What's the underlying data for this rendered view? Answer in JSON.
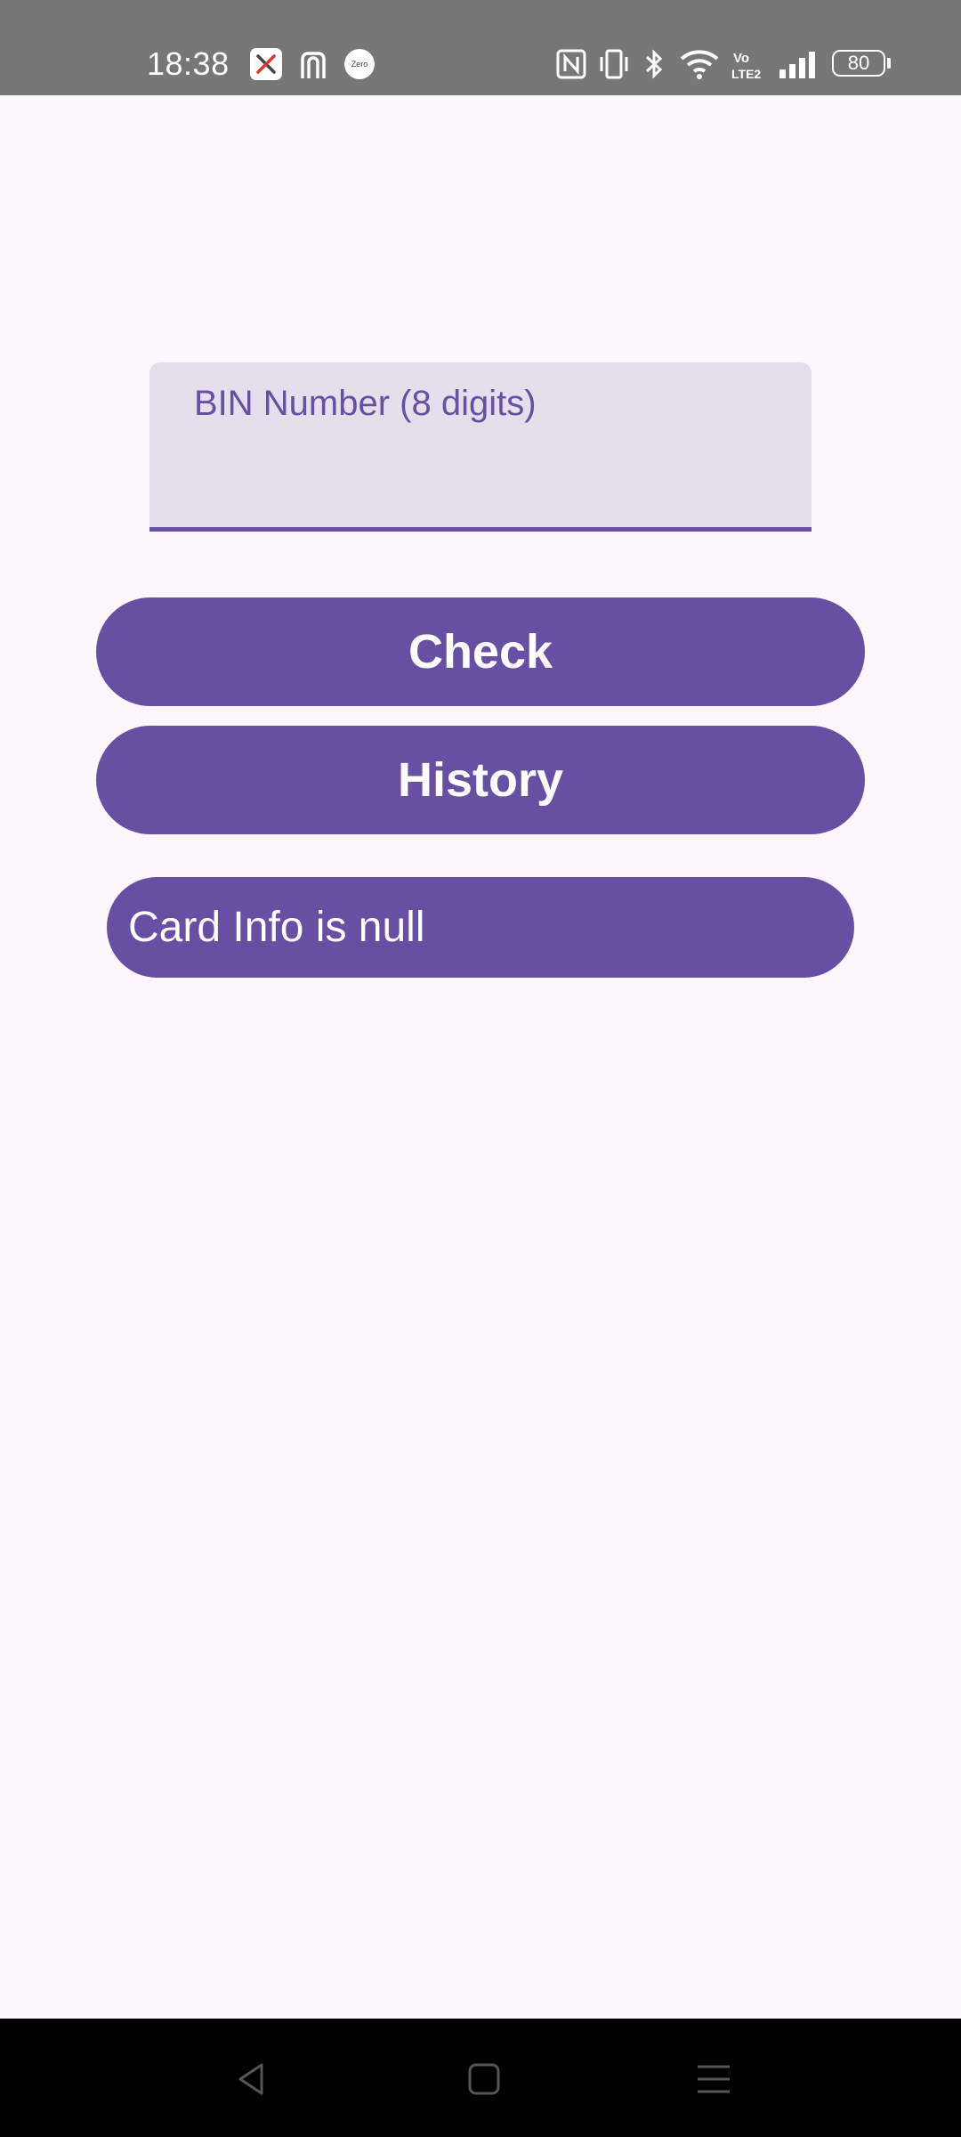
{
  "status_bar": {
    "time": "18:38",
    "battery_level": "80",
    "app_icons": [
      "x-app-icon",
      "shopping-bag-icon",
      "zero-app-icon"
    ],
    "system_icons": [
      "nfc-icon",
      "vibrate-icon",
      "bluetooth-icon",
      "wifi-icon",
      "volte-icon",
      "signal-icon",
      "battery-icon"
    ],
    "zero_badge": "Zero",
    "volte_text": "Vo LTE2"
  },
  "form": {
    "bin_label": "BIN Number (8 digits)",
    "bin_value": ""
  },
  "buttons": {
    "check_label": "Check",
    "history_label": "History"
  },
  "result": {
    "text": "Card Info is null"
  },
  "navigation": {
    "icons": [
      "back-icon",
      "home-icon",
      "menu-icon"
    ]
  },
  "colors": {
    "primary": "#6750a4",
    "field_background": "#e6dfeb",
    "background": "#fef7fd",
    "status_bar": "#777777"
  }
}
